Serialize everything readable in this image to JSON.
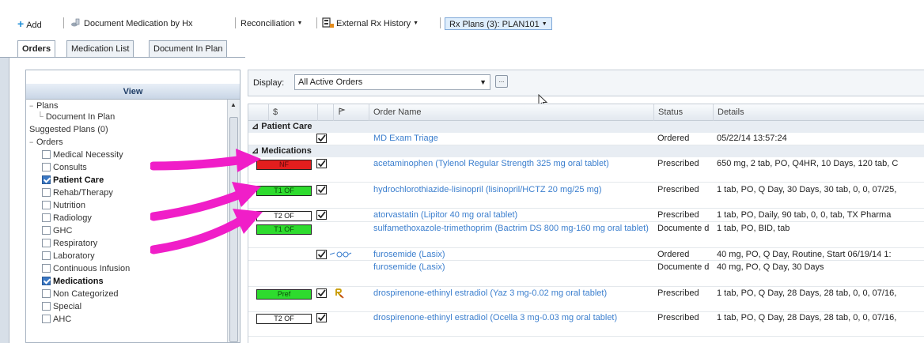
{
  "toolbar": {
    "add": "Add",
    "doc_med": "Document Medication by Hx",
    "reconciliation": "Reconciliation",
    "external_rx": "External Rx History",
    "rx_plans": "Rx Plans (3): PLAN101"
  },
  "tabs": [
    {
      "label": "Orders",
      "active": true
    },
    {
      "label": "Medication List",
      "active": false
    },
    {
      "label": "Document In Plan",
      "active": false
    }
  ],
  "view": {
    "title": "View",
    "tree": [
      {
        "label": "Plans",
        "type": "group"
      },
      {
        "label": "Document In Plan",
        "type": "child"
      },
      {
        "label": "Suggested Plans (0)",
        "type": "plain"
      },
      {
        "label": "Orders",
        "type": "group"
      },
      {
        "label": "Medical Necessity",
        "type": "check",
        "checked": false
      },
      {
        "label": "Consults",
        "type": "check",
        "checked": false
      },
      {
        "label": "Patient Care",
        "type": "check",
        "checked": true
      },
      {
        "label": "Rehab/Therapy",
        "type": "check",
        "checked": false
      },
      {
        "label": "Nutrition",
        "type": "check",
        "checked": false
      },
      {
        "label": "Radiology",
        "type": "check",
        "checked": false
      },
      {
        "label": "GHC",
        "type": "check",
        "checked": false
      },
      {
        "label": "Respiratory",
        "type": "check",
        "checked": false
      },
      {
        "label": "Laboratory",
        "type": "check",
        "checked": false
      },
      {
        "label": "Continuous Infusion",
        "type": "check",
        "checked": false
      },
      {
        "label": "Medications",
        "type": "check",
        "checked": true
      },
      {
        "label": "Non Categorized",
        "type": "check",
        "checked": false
      },
      {
        "label": "Special",
        "type": "check",
        "checked": false
      },
      {
        "label": "AHC",
        "type": "check",
        "checked": false
      }
    ]
  },
  "display": {
    "label": "Display:",
    "value": "All Active Orders",
    "btn": "..."
  },
  "grid": {
    "headers": {
      "dollar": "$",
      "order_name": "Order Name",
      "status": "Status",
      "details": "Details"
    },
    "sections": {
      "patient_care": "Patient Care",
      "medications": "Medications"
    },
    "rows": [
      {
        "badge": "",
        "badge_color": "",
        "check": true,
        "name": "MD Exam Triage",
        "status": "Ordered",
        "details": "05/22/14 13:57:24"
      },
      {
        "badge": "NF",
        "badge_color": "red",
        "check": true,
        "name": "acetaminophen (Tylenol Regular Strength 325 mg oral tablet)",
        "status": "Prescribed",
        "details": "650 mg, 2 tab, PO, Q4HR, 10 Days, 120 tab, C"
      },
      {
        "badge": "T1 OF",
        "badge_color": "green",
        "check": true,
        "name": "hydrochlorothiazide-lisinopril (lisinopril/HCTZ 20 mg/25 mg)",
        "status": "Prescribed",
        "details": "1 tab, PO, Q Day, 30 Days, 30 tab, 0, 0, 07/25,"
      },
      {
        "badge": "T2 OF",
        "badge_color": "white",
        "check": true,
        "name": "atorvastatin (Lipitor 40 mg oral tablet)",
        "status": "Prescribed",
        "details": "1 tab, PO, Daily, 90 tab, 0, 0, tab, TX Pharma"
      },
      {
        "badge": "T1 OF",
        "badge_color": "green",
        "check": false,
        "name": "sulfamethoxazole-trimethoprim (Bactrim DS 800 mg-160 mg oral tablet)",
        "status": "Documente d",
        "details": "1 tab, PO, BID, tab"
      },
      {
        "badge": "",
        "badge_color": "",
        "check": true,
        "glasses": true,
        "name": "furosemide (Lasix)",
        "status": "Ordered",
        "details": "40 mg, PO, Q Day, Routine, Start 06/19/14 1:"
      },
      {
        "badge": "",
        "badge_color": "",
        "check": false,
        "name": "furosemide (Lasix)",
        "status": "Documente d",
        "details": "40 mg, PO, Q Day, 30 Days"
      },
      {
        "badge": "Pref",
        "badge_color": "green",
        "check": true,
        "rx_icon": true,
        "name": "drospirenone-ethinyl estradiol (Yaz 3 mg-0.02 mg oral tablet)",
        "status": "Prescribed",
        "details": "1 tab, PO, Q Day, 28 Days, 28 tab, 0, 0, 07/16,"
      },
      {
        "badge": "T2 OF",
        "badge_color": "white",
        "check": true,
        "name": "drospirenone-ethinyl estradiol (Ocella 3 mg-0.03 mg oral tablet)",
        "status": "Prescribed",
        "details": "1 tab, PO, Q Day, 28 Days, 28 tab, 0, 0, 07/16,"
      }
    ]
  },
  "colors": {
    "accent": "#3c7fce",
    "annotation_arrow": "#f01ec8",
    "badge_red": "#e31e1e",
    "badge_green": "#2edb2e"
  }
}
